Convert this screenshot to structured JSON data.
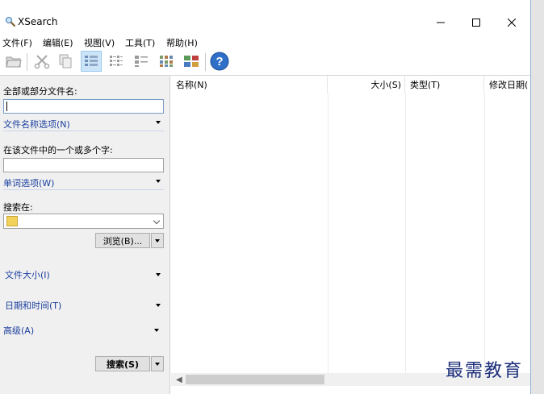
{
  "window": {
    "title": "XSearch"
  },
  "menu": [
    "文件(F)",
    "编辑(E)",
    "视图(V)",
    "工具(T)",
    "帮助(H)"
  ],
  "toolbar": {
    "icons": [
      "open-folder-icon",
      "cut-icon",
      "copy-icon",
      "details-view-icon",
      "list-view-icon",
      "small-icons-view-icon",
      "large-icons-view-icon",
      "thumbnails-view-icon",
      "help-icon"
    ]
  },
  "left": {
    "filename_label": "全部或部分文件名:",
    "filename_value": "",
    "filename_options": "文件名称选项(N)",
    "contains_label": "在该文件中的一个或多个字:",
    "contains_value": "",
    "word_options": "单词选项(W)",
    "search_in_label": "搜索在:",
    "browse_label": "浏览(B)...",
    "file_size": "文件大小(I)",
    "date_time": "日期和时间(T)",
    "advanced": "高级(A)",
    "search_button": "搜索(S)"
  },
  "list": {
    "columns": [
      "名称(N)",
      "大小(S)",
      "类型(T)",
      "修改日期("
    ]
  },
  "watermark": "最需教育"
}
